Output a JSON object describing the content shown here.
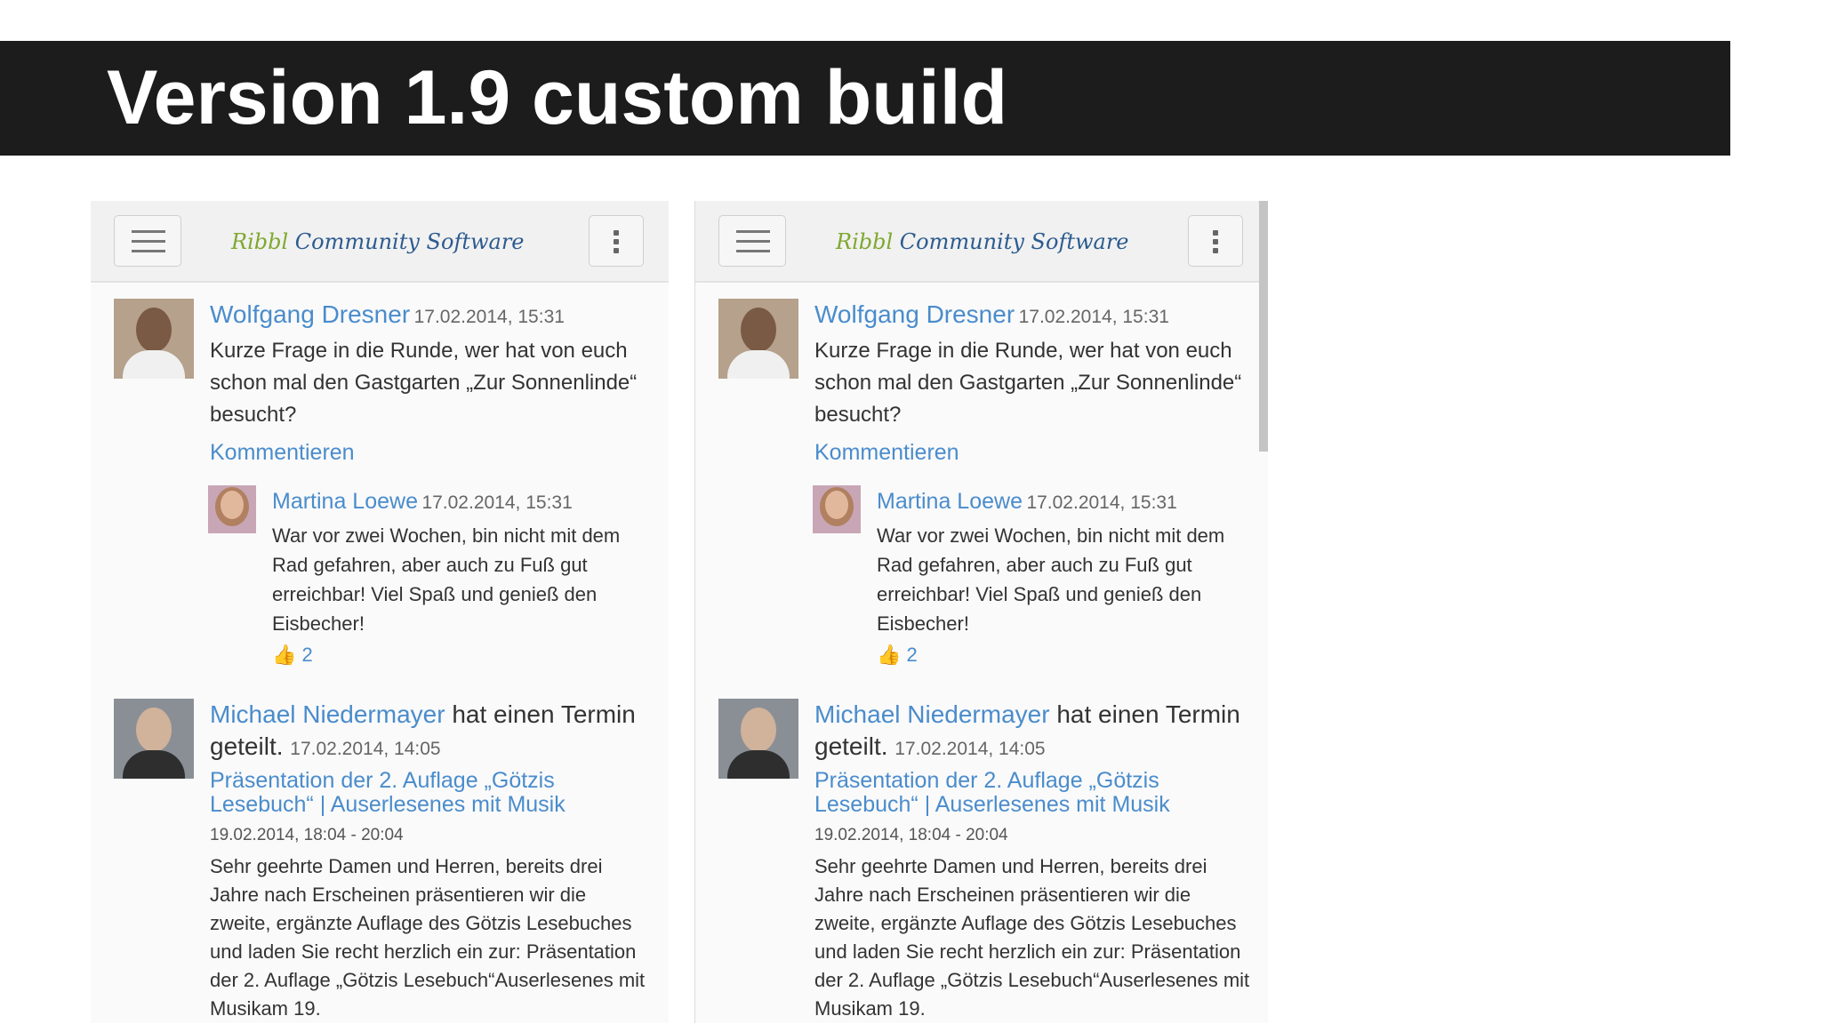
{
  "slide": {
    "title": "Version 1.9 custom build"
  },
  "app": {
    "logo_part1": "Ribbl",
    "logo_part2": "Community Software",
    "menu_icon": "hamburger-icon",
    "more_icon": "kebab-icon"
  },
  "post1": {
    "author": "Wolfgang Dresner",
    "time": "17.02.2014, 15:31",
    "text": "Kurze Frage in die Runde, wer hat von euch schon mal den Gastgarten „Zur Sonnenlinde“ besucht?",
    "comment_label": "Kommentieren",
    "reply": {
      "author": "Martina Loewe",
      "time": "17.02.2014, 15:31",
      "text": "War vor zwei Wochen, bin nicht mit dem Rad gefahren, aber auch zu Fuß gut erreichbar! Viel Spaß und genieß den Eisbecher!",
      "like_icon": "thumbs-up-icon",
      "like_count": "2"
    }
  },
  "post2": {
    "author": "Michael Niedermayer",
    "action": "hat einen Termin geteilt.",
    "time": "17.02.2014, 14:05",
    "event_title": "Präsentation der 2. Auflage „Götzis Lesebuch“ | Auserlesenes mit Musik",
    "event_date": "19.02.2014, 18:04 - 20:04",
    "event_text": "Sehr geehrte Damen und Herren,   bereits drei Jahre nach Erscheinen präsentieren wir die zweite, ergänzte Auflage des Götzis Lesebuches und laden Sie recht herzlich ein zur: Präsentation der 2. Auflage „Götzis Lesebuch“Auserlesenes mit Musikam 19."
  }
}
